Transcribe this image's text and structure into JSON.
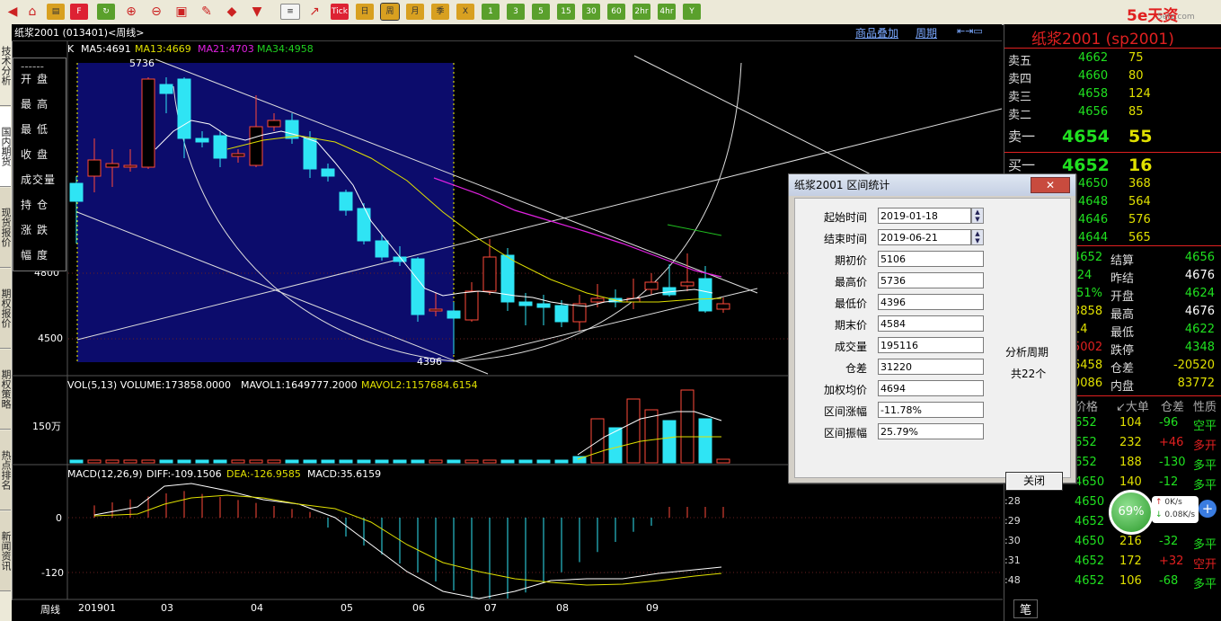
{
  "toolbar": {
    "tick_label": "Tick",
    "zhou_label": "周",
    "ri_label": "日",
    "yue_label": "月",
    "ji_label": "季",
    "nian_label": "X",
    "min1": "1",
    "min3": "3",
    "min5": "5",
    "min15": "15",
    "min30": "30",
    "min60": "60",
    "hr2": "2hr",
    "hr4": "4hr",
    "year": "Y"
  },
  "brand": {
    "logo_text": "5e天资",
    "sub": "5etz.com"
  },
  "left_tabs": [
    "技术分析",
    "国内期货",
    "现货报价",
    "期权报价",
    "期权策略",
    "热点排名",
    "新闻资讯"
  ],
  "chart_header": {
    "title": "纸浆2001 (013401)<周线>",
    "overlay_button": "商品叠加",
    "period_button": "周期"
  },
  "ma_line": {
    "k": "K",
    "ma5": "MA5:4691",
    "ma13": "MA13:4669",
    "ma21": "MA21:4703",
    "ma34": "MA34:4958"
  },
  "price_labels": {
    "high_mark": "5736",
    "low_mark": "4396",
    "y4800": "4800",
    "y4500": "4500"
  },
  "info_panel": [
    "开盘",
    "最高",
    "最低",
    "收盘",
    "成交量",
    "持仓",
    "涨跌",
    "幅度"
  ],
  "volume": {
    "header_vol": "VOL(5,13) VOLUME:173858.0000",
    "header_mavol1": "MAVOL1:1649777.2000",
    "header_mavol2": "MAVOL2:1157684.6154",
    "axis_label": "150万"
  },
  "macd": {
    "header_name": "MACD(12,26,9)",
    "header_diff": "DIFF:-109.1506",
    "header_dea": "DEA:-126.9585",
    "header_macd": "MACD:35.6159",
    "axis_zero": "0",
    "axis_neg": "-120"
  },
  "xaxis": {
    "period_label": "周线",
    "ticks": [
      "201901",
      "03",
      "04",
      "05",
      "06",
      "07",
      "08",
      "09"
    ]
  },
  "right_panel": {
    "title": "纸浆2001 (sp2001)",
    "asks": [
      {
        "label": "卖五",
        "price": "4662",
        "vol": "75"
      },
      {
        "label": "卖四",
        "price": "4660",
        "vol": "80"
      },
      {
        "label": "卖三",
        "price": "4658",
        "vol": "124"
      },
      {
        "label": "卖二",
        "price": "4656",
        "vol": "85"
      },
      {
        "label": "卖一",
        "price": "4654",
        "vol": "55"
      }
    ],
    "bids": [
      {
        "label": "买一",
        "price": "4652",
        "vol": "16"
      },
      {
        "label": "买二",
        "price": "4650",
        "vol": "368"
      },
      {
        "label": "买三",
        "price": "4648",
        "vol": "564"
      },
      {
        "label": "买四",
        "price": "4646",
        "vol": "576"
      },
      {
        "label": "买五",
        "price": "4644",
        "vol": "565"
      }
    ],
    "stats": [
      {
        "v1": "4652",
        "k": "结算",
        "v2": "4656"
      },
      {
        "v1": "-24",
        "k": "昨结",
        "v2": "4676"
      },
      {
        "v1": ".51%",
        "k": "开盘",
        "v2": "4624"
      },
      {
        "v1": "3858",
        "k": "最高",
        "v2": "4676"
      },
      {
        "v1": "14",
        "k": "最低",
        "v2": "4622"
      },
      {
        "v1": "5002",
        "k": "跌停",
        "v2": "4348"
      },
      {
        "v1": "6458",
        "k": "仓差",
        "v2": "-20520"
      },
      {
        "v1": "0086",
        "k": "内盘",
        "v2": "83772"
      }
    ],
    "tick_header": [
      "价格",
      "↙大单",
      "仓差",
      "性质"
    ],
    "ticks": [
      {
        "t": "",
        "p": "652",
        "v": "104",
        "d": "-96",
        "n": "空平"
      },
      {
        "t": "",
        "p": "652",
        "v": "232",
        "d": "+46",
        "n": "多开"
      },
      {
        "t": "",
        "p": "652",
        "v": "188",
        "d": "-130",
        "n": "多平"
      },
      {
        "t": ":21",
        "p": "4650",
        "v": "140",
        "d": "-12",
        "n": "多平"
      },
      {
        "t": ":28",
        "p": "4650",
        "v": "",
        "d": "",
        "n": ""
      },
      {
        "t": ":29",
        "p": "4652",
        "v": "",
        "d": "",
        "n": ""
      },
      {
        "t": ":30",
        "p": "4650",
        "v": "216",
        "d": "-32",
        "n": "多平"
      },
      {
        "t": ":31",
        "p": "4652",
        "v": "172",
        "d": "+32",
        "n": "空开"
      },
      {
        "t": ":48",
        "p": "4652",
        "v": "106",
        "d": "-68",
        "n": "多平"
      }
    ],
    "bottom_tab": "笔"
  },
  "speed_gauge": {
    "percent": "69%",
    "up": "0K/s",
    "down": "0.08K/s"
  },
  "dialog": {
    "title": "纸浆2001 区间统计",
    "fields": [
      {
        "label": "起始时间",
        "value": "2019-01-18"
      },
      {
        "label": "结束时间",
        "value": "2019-06-21"
      },
      {
        "label": "期初价",
        "value": "5106"
      },
      {
        "label": "最高价",
        "value": "5736"
      },
      {
        "label": "最低价",
        "value": "4396"
      },
      {
        "label": "期末价",
        "value": "4584"
      },
      {
        "label": "成交量",
        "value": "195116"
      },
      {
        "label": "仓差",
        "value": "31220"
      },
      {
        "label": "加权均价",
        "value": "4694"
      },
      {
        "label": "区间涨幅",
        "value": "-11.78%"
      },
      {
        "label": "区间振幅",
        "value": "25.79%"
      }
    ],
    "period_label": "分析周期",
    "period_value": "共22个",
    "close_button": "关闭"
  }
}
